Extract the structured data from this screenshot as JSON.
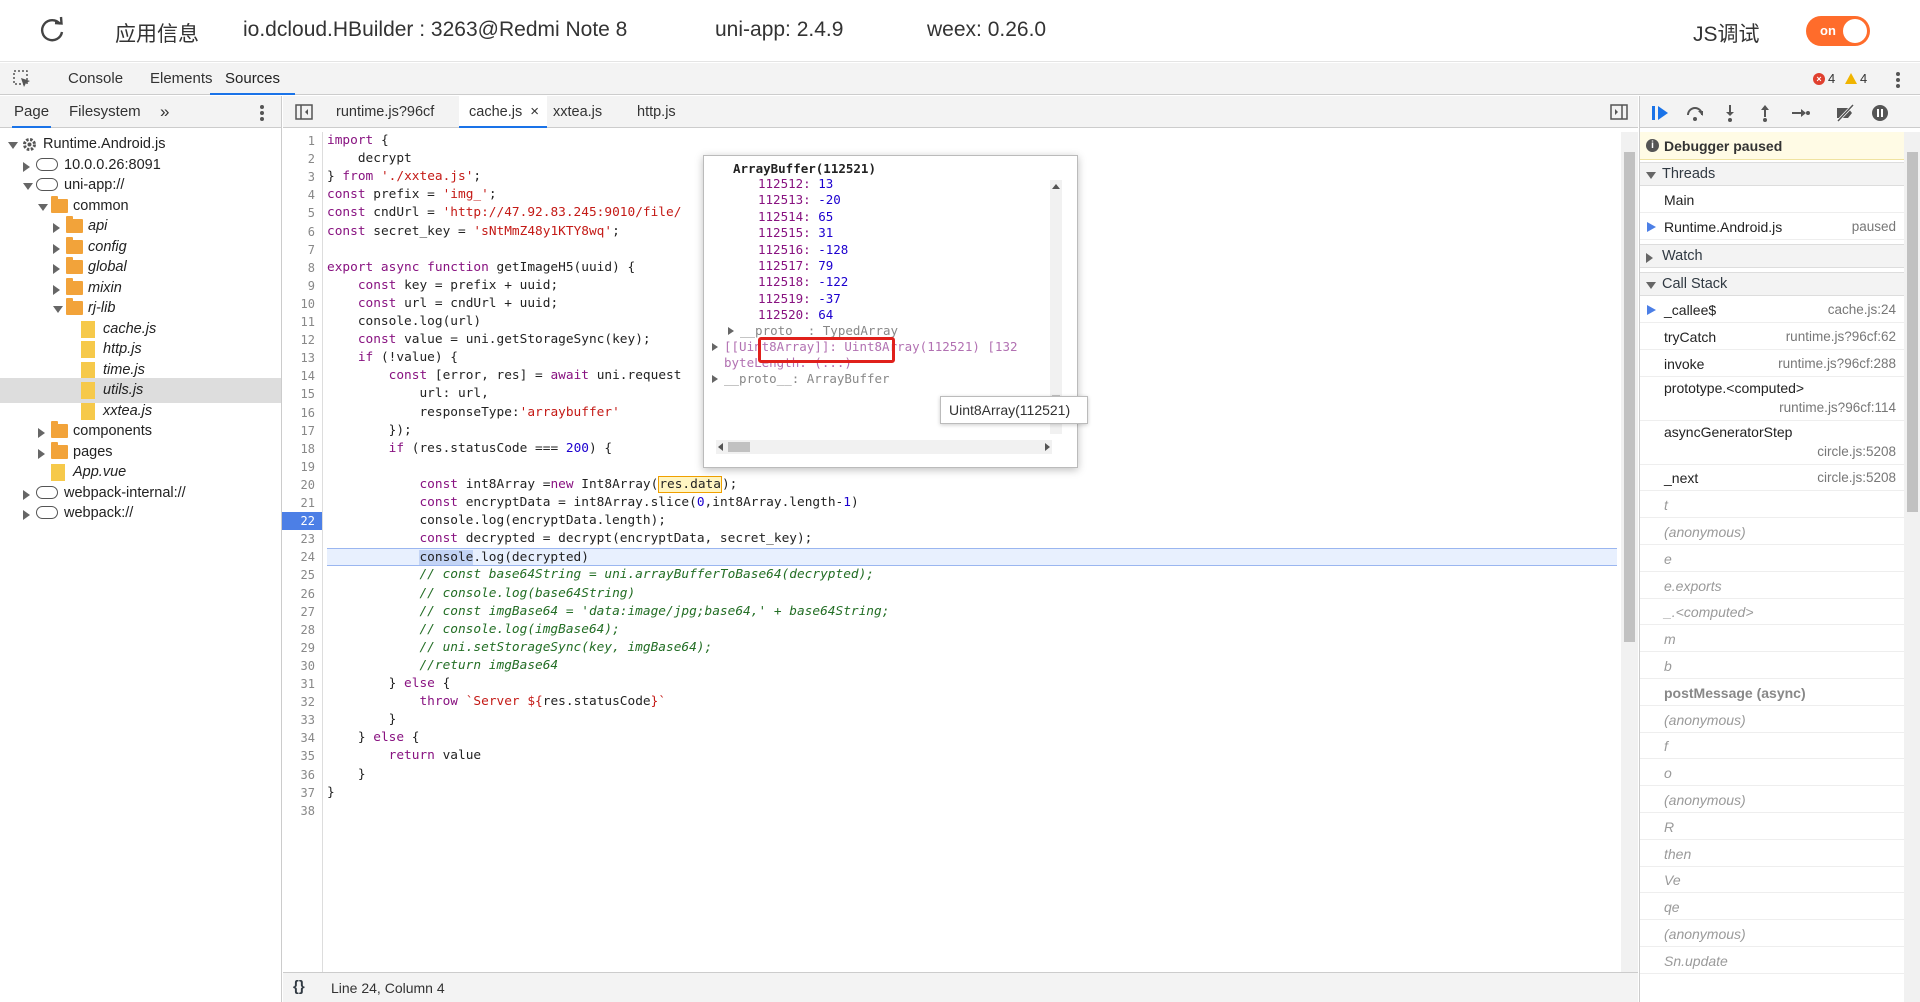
{
  "app": {
    "title": "应用信息",
    "device": "io.dcloud.HBuilder : 3263@Redmi Note 8",
    "uniapp": "uni-app: 2.4.9",
    "weex": "weex: 0.26.0",
    "js_debug": "JS调试",
    "toggle": "on"
  },
  "devtools": {
    "tabs": [
      "Console",
      "Elements",
      "Sources"
    ],
    "active_tab": "Sources",
    "errors": "4",
    "warnings": "4"
  },
  "navigator": {
    "tabs": [
      "Page",
      "Filesystem"
    ],
    "more": "»",
    "tree": [
      {
        "label": "Runtime.Android.js",
        "depth": 0,
        "kind": "gear",
        "open": true
      },
      {
        "label": "10.0.0.26:8091",
        "depth": 1,
        "kind": "cloud",
        "open": false
      },
      {
        "label": "uni-app://",
        "depth": 1,
        "kind": "cloud",
        "open": true
      },
      {
        "label": "common",
        "depth": 2,
        "kind": "folder",
        "open": true
      },
      {
        "label": "api",
        "depth": 3,
        "kind": "folder",
        "open": false
      },
      {
        "label": "config",
        "depth": 3,
        "kind": "folder",
        "open": false
      },
      {
        "label": "global",
        "depth": 3,
        "kind": "folder",
        "open": false
      },
      {
        "label": "mixin",
        "depth": 3,
        "kind": "folder",
        "open": false
      },
      {
        "label": "rj-lib",
        "depth": 3,
        "kind": "folder",
        "open": true
      },
      {
        "label": "cache.js",
        "depth": 4,
        "kind": "file"
      },
      {
        "label": "http.js",
        "depth": 4,
        "kind": "file"
      },
      {
        "label": "time.js",
        "depth": 4,
        "kind": "file"
      },
      {
        "label": "utils.js",
        "depth": 4,
        "kind": "file",
        "selected": true
      },
      {
        "label": "xxtea.js",
        "depth": 4,
        "kind": "file"
      },
      {
        "label": "components",
        "depth": 2,
        "kind": "folder",
        "open": false
      },
      {
        "label": "pages",
        "depth": 2,
        "kind": "folder",
        "open": false
      },
      {
        "label": "App.vue",
        "depth": 2,
        "kind": "file"
      },
      {
        "label": "webpack-internal://",
        "depth": 1,
        "kind": "cloud",
        "open": false
      },
      {
        "label": "webpack://",
        "depth": 1,
        "kind": "cloud",
        "open": false
      }
    ]
  },
  "editor": {
    "tabs": [
      {
        "label": "runtime.js?96cf",
        "active": false
      },
      {
        "label": "cache.js",
        "active": true,
        "close": "×"
      },
      {
        "label": "xxtea.js",
        "active": false
      },
      {
        "label": "http.js",
        "active": false
      }
    ],
    "breakpoint_line": "22",
    "exec_line": "24",
    "status": "Line 24, Column 4",
    "format_icon": "{}"
  },
  "popover": {
    "title": "ArrayBuffer(112521)",
    "entries": [
      {
        "k": "112512",
        "v": "13"
      },
      {
        "k": "112513",
        "v": "-20"
      },
      {
        "k": "112514",
        "v": "65"
      },
      {
        "k": "112515",
        "v": "31"
      },
      {
        "k": "112516",
        "v": "-128"
      },
      {
        "k": "112517",
        "v": "79"
      },
      {
        "k": "112518",
        "v": "-122"
      },
      {
        "k": "112519",
        "v": "-37"
      },
      {
        "k": "112520",
        "v": "64"
      }
    ],
    "proto_typed": "__proto__: TypedArray",
    "uint8_row": "[[Uint8Array]]: Uint8Array(112521) [132",
    "bytelength": "byteLength: (...)",
    "proto_ab": "__proto__: ArrayBuffer",
    "tooltip": "Uint8Array(112521)"
  },
  "debugger": {
    "paused": "Debugger paused",
    "threads_label": "Threads",
    "threads": [
      {
        "name": "Main",
        "status": ""
      },
      {
        "name": "Runtime.Android.js",
        "status": "paused",
        "current": true
      }
    ],
    "watch_label": "Watch",
    "callstack_label": "Call Stack",
    "callstack": [
      {
        "fn": "_callee$",
        "loc": "cache.js:24",
        "current": true
      },
      {
        "fn": "tryCatch",
        "loc": "runtime.js?96cf:62"
      },
      {
        "fn": "invoke",
        "loc": "runtime.js?96cf:288"
      },
      {
        "fn": "prototype.<computed>",
        "loc": "runtime.js?96cf:114",
        "tall": true
      },
      {
        "fn": "asyncGeneratorStep",
        "loc": "circle.js:5208",
        "tall": true
      },
      {
        "fn": "_next",
        "loc": "circle.js:5208"
      },
      {
        "fn": "t",
        "loc": "",
        "dim": true
      },
      {
        "fn": "(anonymous)",
        "loc": "",
        "dim": true
      },
      {
        "fn": "e",
        "loc": "",
        "dim": true
      },
      {
        "fn": "e.exports",
        "loc": "",
        "dim": true
      },
      {
        "fn": "_.<computed>",
        "loc": "",
        "dim": true
      },
      {
        "fn": "m",
        "loc": "",
        "dim": true
      },
      {
        "fn": "b",
        "loc": "",
        "dim": true
      },
      {
        "fn": "postMessage (async)",
        "loc": "",
        "async": true
      },
      {
        "fn": "(anonymous)",
        "loc": "",
        "dim": true
      },
      {
        "fn": "f",
        "loc": "",
        "dim": true
      },
      {
        "fn": "o",
        "loc": "",
        "dim": true
      },
      {
        "fn": "(anonymous)",
        "loc": "",
        "dim": true
      },
      {
        "fn": "R",
        "loc": "",
        "dim": true
      },
      {
        "fn": "then",
        "loc": "",
        "dim": true
      },
      {
        "fn": "Ve",
        "loc": "",
        "dim": true
      },
      {
        "fn": "qe",
        "loc": "",
        "dim": true
      },
      {
        "fn": "(anonymous)",
        "loc": "",
        "dim": true
      },
      {
        "fn": "Sn.update",
        "loc": "",
        "dim": true
      }
    ]
  },
  "code_lines": [
    [
      [
        "kw",
        "import"
      ],
      [
        "t",
        " {"
      ]
    ],
    [
      [
        "t",
        "    decrypt"
      ]
    ],
    [
      [
        "t",
        "} "
      ],
      [
        "kw",
        "from"
      ],
      [
        "t",
        " "
      ],
      [
        "str",
        "'./xxtea.js'"
      ],
      [
        "t",
        ";"
      ]
    ],
    [
      [
        "kw",
        "const"
      ],
      [
        "t",
        " prefix = "
      ],
      [
        "str",
        "'img_'"
      ],
      [
        "t",
        ";"
      ]
    ],
    [
      [
        "kw",
        "const"
      ],
      [
        "t",
        " cndUrl = "
      ],
      [
        "str",
        "'http://47.92.83.245:9010/file/"
      ]
    ],
    [
      [
        "kw",
        "const"
      ],
      [
        "t",
        " secret_key = "
      ],
      [
        "str",
        "'sNtMmZ48y1KTY8wq'"
      ],
      [
        "t",
        ";"
      ]
    ],
    [
      [
        "t",
        ""
      ]
    ],
    [
      [
        "kw",
        "export async function"
      ],
      [
        "t",
        " getImageH5(uuid) {"
      ]
    ],
    [
      [
        "t",
        "    "
      ],
      [
        "kw",
        "const"
      ],
      [
        "t",
        " key = prefix + uuid;"
      ]
    ],
    [
      [
        "t",
        "    "
      ],
      [
        "kw",
        "const"
      ],
      [
        "t",
        " url = cndUrl + uuid;"
      ]
    ],
    [
      [
        "t",
        "    console.log(url)"
      ]
    ],
    [
      [
        "t",
        "    "
      ],
      [
        "kw",
        "const"
      ],
      [
        "t",
        " value = uni.getStorageSync(key);"
      ]
    ],
    [
      [
        "t",
        "    "
      ],
      [
        "kw",
        "if"
      ],
      [
        "t",
        " (!value) {"
      ]
    ],
    [
      [
        "t",
        "        "
      ],
      [
        "kw",
        "const"
      ],
      [
        "t",
        " [error, res] = "
      ],
      [
        "kw",
        "await"
      ],
      [
        "t",
        " uni.request"
      ]
    ],
    [
      [
        "t",
        "            url: url,"
      ]
    ],
    [
      [
        "t",
        "            responseType:"
      ],
      [
        "str",
        "'arraybuffer'"
      ]
    ],
    [
      [
        "t",
        "        });"
      ]
    ],
    [
      [
        "t",
        "        "
      ],
      [
        "kw",
        "if"
      ],
      [
        "t",
        " (res.statusCode === "
      ],
      [
        "num",
        "200"
      ],
      [
        "t",
        ") {"
      ]
    ],
    [
      [
        "t",
        ""
      ]
    ],
    [
      [
        "t",
        "            "
      ],
      [
        "kw",
        "const"
      ],
      [
        "t",
        " int8Array ="
      ],
      [
        "kw",
        "new"
      ],
      [
        "t",
        " Int8Array("
      ],
      [
        "box",
        "res.data"
      ],
      [
        "t",
        ");"
      ]
    ],
    [
      [
        "t",
        "            "
      ],
      [
        "kw",
        "const"
      ],
      [
        "t",
        " encryptData = int8Array.slice("
      ],
      [
        "num",
        "0"
      ],
      [
        "t",
        ",int8Array.length-"
      ],
      [
        "num",
        "1"
      ],
      [
        "t",
        ")"
      ]
    ],
    [
      [
        "t",
        "            console.log(encryptData.length);"
      ]
    ],
    [
      [
        "t",
        "            "
      ],
      [
        "kw",
        "const"
      ],
      [
        "t",
        " decrypted = decrypt(encryptData, secret_key);"
      ]
    ],
    [
      [
        "t",
        "            "
      ],
      [
        "sel",
        "console"
      ],
      [
        "t",
        ".log(decrypted)"
      ]
    ],
    [
      [
        "t",
        "            "
      ],
      [
        "cmt",
        "// const base64String = uni.arrayBufferToBase64(decrypted);"
      ]
    ],
    [
      [
        "t",
        "            "
      ],
      [
        "cmt",
        "// console.log(base64String)"
      ]
    ],
    [
      [
        "t",
        "            "
      ],
      [
        "cmt",
        "// const imgBase64 = 'data:image/jpg;base64,' + base64String;"
      ]
    ],
    [
      [
        "t",
        "            "
      ],
      [
        "cmt",
        "// console.log(imgBase64);"
      ]
    ],
    [
      [
        "t",
        "            "
      ],
      [
        "cmt",
        "// uni.setStorageSync(key, imgBase64);"
      ]
    ],
    [
      [
        "t",
        "            "
      ],
      [
        "cmt",
        "//return imgBase64"
      ]
    ],
    [
      [
        "t",
        "        } "
      ],
      [
        "kw",
        "else"
      ],
      [
        "t",
        " {"
      ]
    ],
    [
      [
        "t",
        "            "
      ],
      [
        "kw",
        "throw"
      ],
      [
        "t",
        " "
      ],
      [
        "str",
        "`Server ${"
      ],
      [
        "t",
        "res.statusCode"
      ],
      [
        "str",
        "}`"
      ]
    ],
    [
      [
        "t",
        "        }"
      ]
    ],
    [
      [
        "t",
        "    } "
      ],
      [
        "kw",
        "else"
      ],
      [
        "t",
        " {"
      ]
    ],
    [
      [
        "t",
        "        "
      ],
      [
        "kw",
        "return"
      ],
      [
        "t",
        " value"
      ]
    ],
    [
      [
        "t",
        "    }"
      ]
    ],
    [
      [
        "t",
        "}"
      ]
    ],
    [
      [
        "t",
        ""
      ]
    ]
  ]
}
